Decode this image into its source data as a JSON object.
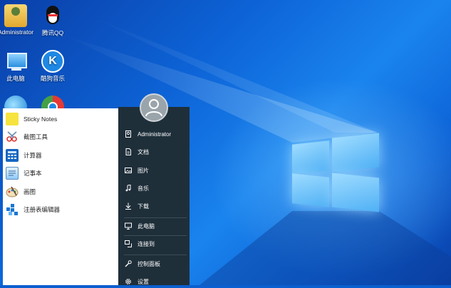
{
  "desktop": {
    "icons": [
      {
        "label": "Administrator",
        "icon": "user-folder-icon"
      },
      {
        "label": "腾讯QQ",
        "icon": "qq-penguin-icon"
      },
      {
        "label": "此电脑",
        "icon": "computer-icon"
      },
      {
        "label": "酷狗音乐",
        "icon": "kugou-music-icon"
      },
      {
        "label": "",
        "icon": "network-globe-icon"
      },
      {
        "label": "",
        "icon": "chrome-icon"
      }
    ]
  },
  "start_menu": {
    "apps": [
      {
        "label": "Sticky Notes",
        "icon": "sticky-notes-icon"
      },
      {
        "label": "截图工具",
        "icon": "snipping-tool-icon"
      },
      {
        "label": "计算器",
        "icon": "calculator-icon"
      },
      {
        "label": "记事本",
        "icon": "notepad-icon"
      },
      {
        "label": "画图",
        "icon": "paint-icon"
      },
      {
        "label": "注册表编辑器",
        "icon": "registry-editor-icon"
      }
    ],
    "right_items": [
      {
        "label": "Administrator",
        "icon": "user-icon"
      },
      {
        "label": "文档",
        "icon": "document-icon"
      },
      {
        "label": "图片",
        "icon": "picture-icon"
      },
      {
        "label": "音乐",
        "icon": "music-icon"
      },
      {
        "label": "下载",
        "icon": "download-icon"
      },
      {
        "label": "此电脑",
        "icon": "computer-icon"
      },
      {
        "label": "连接到",
        "icon": "connect-icon"
      },
      {
        "label": "控制面板",
        "icon": "control-panel-icon"
      },
      {
        "label": "设置",
        "icon": "settings-gear-icon"
      }
    ]
  },
  "colors": {
    "desktop_blue": "#0d63d6",
    "start_panel": "#1f2f3a",
    "app_list_bg": "#ffffff"
  }
}
